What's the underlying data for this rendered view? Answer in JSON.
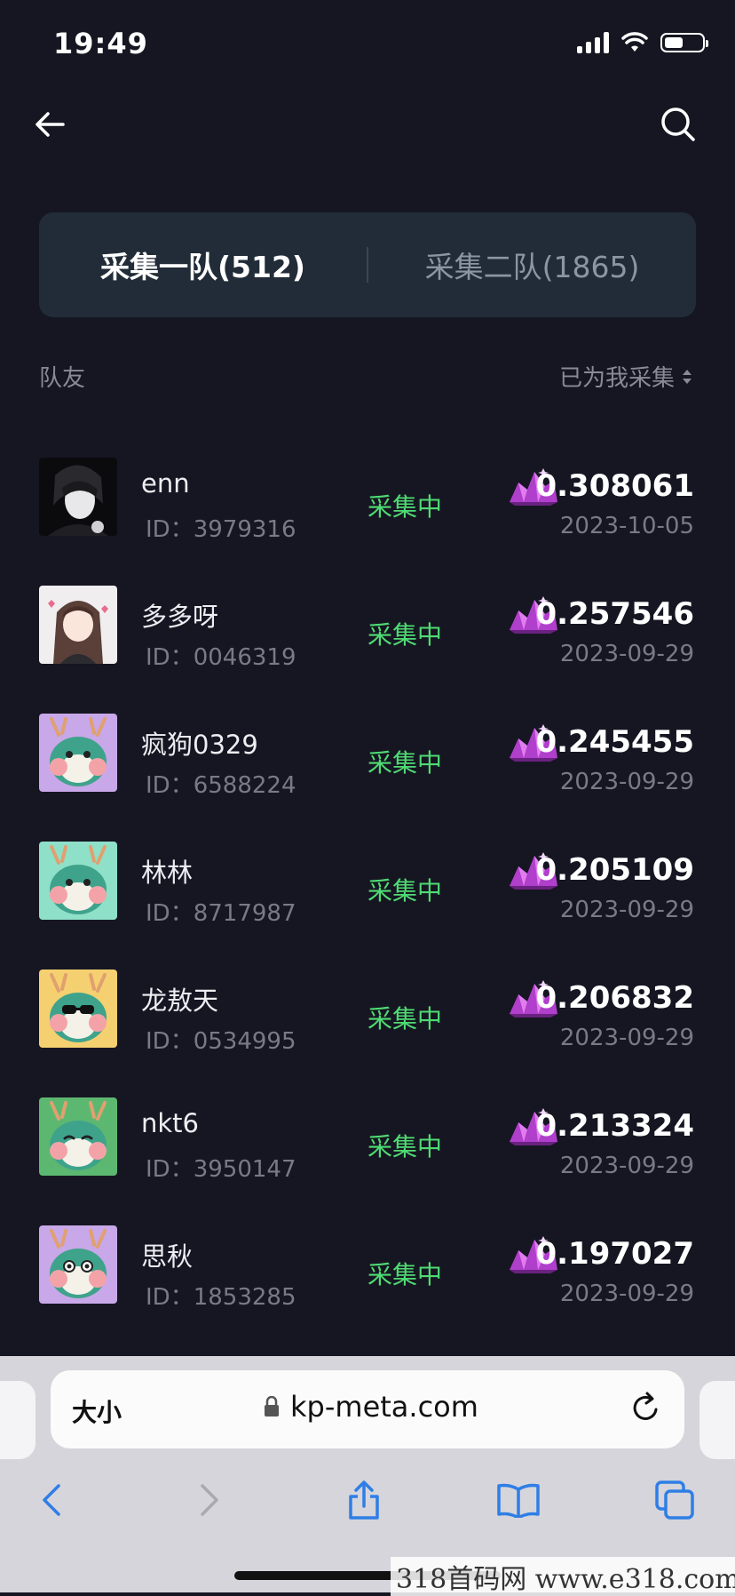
{
  "status_bar": {
    "time": "19:49"
  },
  "tabs": [
    {
      "label": "采集一队(512)",
      "active": true
    },
    {
      "label": "采集二队(1865)",
      "active": false
    }
  ],
  "list_header": {
    "left": "队友",
    "right": "已为我采集"
  },
  "colors": {
    "background": "#161622",
    "status_green": "#4fdb73",
    "tab_bg": "#212c38",
    "crystal": "#c24fd6"
  },
  "members": [
    {
      "name": "enn",
      "id": "ID：3979316",
      "status": "采集中",
      "amount": "0.308061",
      "date": "2023-10-05",
      "avatar": "anime-boy"
    },
    {
      "name": "多多呀",
      "id": "ID：0046319",
      "status": "采集中",
      "amount": "0.257546",
      "date": "2023-09-29",
      "avatar": "anime-girl"
    },
    {
      "name": "疯狗0329",
      "id": "ID：6588224",
      "status": "采集中",
      "amount": "0.245455",
      "date": "2023-09-29",
      "avatar": "dragon-purple"
    },
    {
      "name": "林林",
      "id": "ID：8717987",
      "status": "采集中",
      "amount": "0.205109",
      "date": "2023-09-29",
      "avatar": "dragon-teal"
    },
    {
      "name": "龙敖天",
      "id": "ID：0534995",
      "status": "采集中",
      "amount": "0.206832",
      "date": "2023-09-29",
      "avatar": "dragon-yellow"
    },
    {
      "name": "nkt6",
      "id": "ID：3950147",
      "status": "采集中",
      "amount": "0.213324",
      "date": "2023-09-29",
      "avatar": "dragon-green"
    },
    {
      "name": "思秋",
      "id": "ID：1853285",
      "status": "采集中",
      "amount": "0.197027",
      "date": "2023-09-29",
      "avatar": "dragon-lilac"
    }
  ],
  "browser": {
    "aa": "大小",
    "url": "kp-meta.com"
  },
  "watermark": "318首码网 www.e318.com"
}
